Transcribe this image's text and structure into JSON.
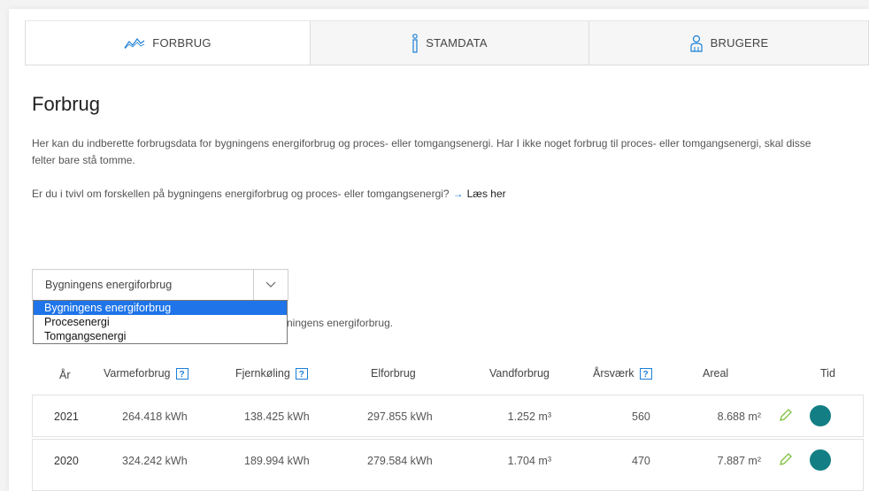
{
  "tabs": [
    {
      "label": "FORBRUG",
      "icon": "chart-line-icon",
      "active": true
    },
    {
      "label": "STAMDATA",
      "icon": "info-icon",
      "active": false
    },
    {
      "label": "BRUGERE",
      "icon": "users-icon",
      "active": false
    }
  ],
  "page": {
    "title": "Forbrug",
    "intro": "Her kan du indberette forbrugsdata for bygningens energiforbrug og proces- eller tomgangsenergi. Har I ikke noget forbrug til proces- eller tomgangsenergi, skal disse felter bare stå tomme.",
    "question": "Er du i tvivl om forskellen på bygningens energiforbrug og proces- eller tomgangsenergi?",
    "link_label": "Læs her"
  },
  "select": {
    "value": "Bygningens energiforbrug",
    "options": [
      "Bygningens energiforbrug",
      "Procesenergi",
      "Tomgangsenergi"
    ]
  },
  "behind_text": "ningens energiforbrug.",
  "table": {
    "headers": {
      "year": "År",
      "heat": "Varmeforbrug",
      "cooling": "Fjernkøling",
      "elec": "Elforbrug",
      "water": "Vandforbrug",
      "staff": "Årsværk",
      "area": "Areal",
      "time": "Tid"
    },
    "help_glyph": "?",
    "rows": [
      {
        "year": "2021",
        "heat": "264.418 kWh",
        "cooling": "138.425 kWh",
        "elec": "297.855 kWh",
        "water": "1.252 m³",
        "staff": "560",
        "area": "8.688 m²"
      },
      {
        "year": "2020",
        "heat": "324.242 kWh",
        "cooling": "189.994 kWh",
        "elec": "279.584 kWh",
        "water": "1.704 m³",
        "staff": "470",
        "area": "7.887 m²"
      }
    ]
  },
  "colors": {
    "accent": "#1b7fd6",
    "status_dot": "#137f84",
    "edit_icon": "#7bbf3a",
    "selected_option": "#1e74e8"
  }
}
